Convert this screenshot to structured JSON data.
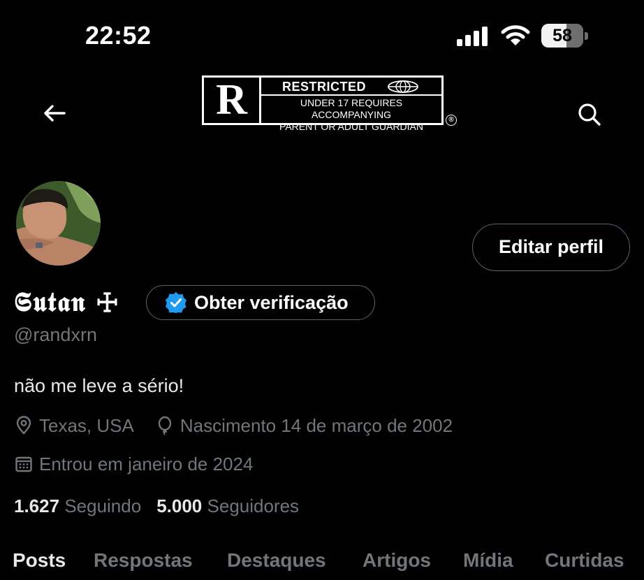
{
  "status_bar": {
    "time": "22:52",
    "battery": "58",
    "icons": [
      "signal-bars-icon",
      "wifi-icon",
      "battery-icon"
    ]
  },
  "header": {
    "back_icon": "arrow-left-icon",
    "search_icon": "search-icon",
    "banner": {
      "letter": "R",
      "title": "RESTRICTED",
      "line1": "UNDER 17 REQUIRES ACCOMPANYING",
      "line2": "PARENT OR ADULT GUARDIAN",
      "registered": "®"
    }
  },
  "profile": {
    "display_name": "𝕾𝖚𝖙𝖆𝖓 ☩",
    "handle": "@randxrn",
    "bio": "não me leve a sério!",
    "location": "Texas, USA",
    "birth": "Nascimento 14 de março de 2002",
    "joined": "Entrou em janeiro de 2024",
    "edit_label": "Editar perfil",
    "verify_label": "Obter verificação",
    "colors": {
      "verified_blue": "#1d9bf0",
      "muted": "#71767b",
      "text": "#e7e9ea"
    }
  },
  "stats": {
    "following_count": "1.627",
    "following_label": "Seguindo",
    "followers_count": "5.000",
    "followers_label": "Seguidores"
  },
  "tabs": [
    {
      "label": "Posts",
      "active": true
    },
    {
      "label": "Respostas"
    },
    {
      "label": "Destaques"
    },
    {
      "label": "Artigos"
    },
    {
      "label": "Mídia"
    },
    {
      "label": "Curtidas"
    }
  ]
}
